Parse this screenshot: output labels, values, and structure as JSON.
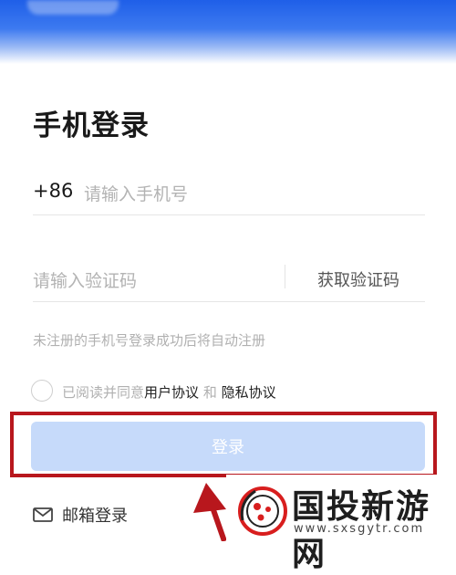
{
  "page": {
    "title": "手机登录"
  },
  "phone": {
    "country_code": "+86",
    "placeholder": "请输入手机号"
  },
  "code": {
    "placeholder": "请输入验证码",
    "get_code_label": "获取验证码"
  },
  "hint": "未注册的手机号登录成功后将自动注册",
  "agreement": {
    "prefix": "已阅读并同意",
    "user_agreement": "用户协议",
    "and": "和",
    "privacy_agreement": "隐私协议"
  },
  "login_button": {
    "label": "登录"
  },
  "email_login": {
    "label": "邮箱登录",
    "icon": "mail-icon"
  },
  "watermark": {
    "title": "国投新游网",
    "url": "www.sxsgytr.com"
  },
  "colors": {
    "highlight": "#b8171d",
    "button_bg": "#c6dafa",
    "brand_blue": "#1f5fe8"
  }
}
